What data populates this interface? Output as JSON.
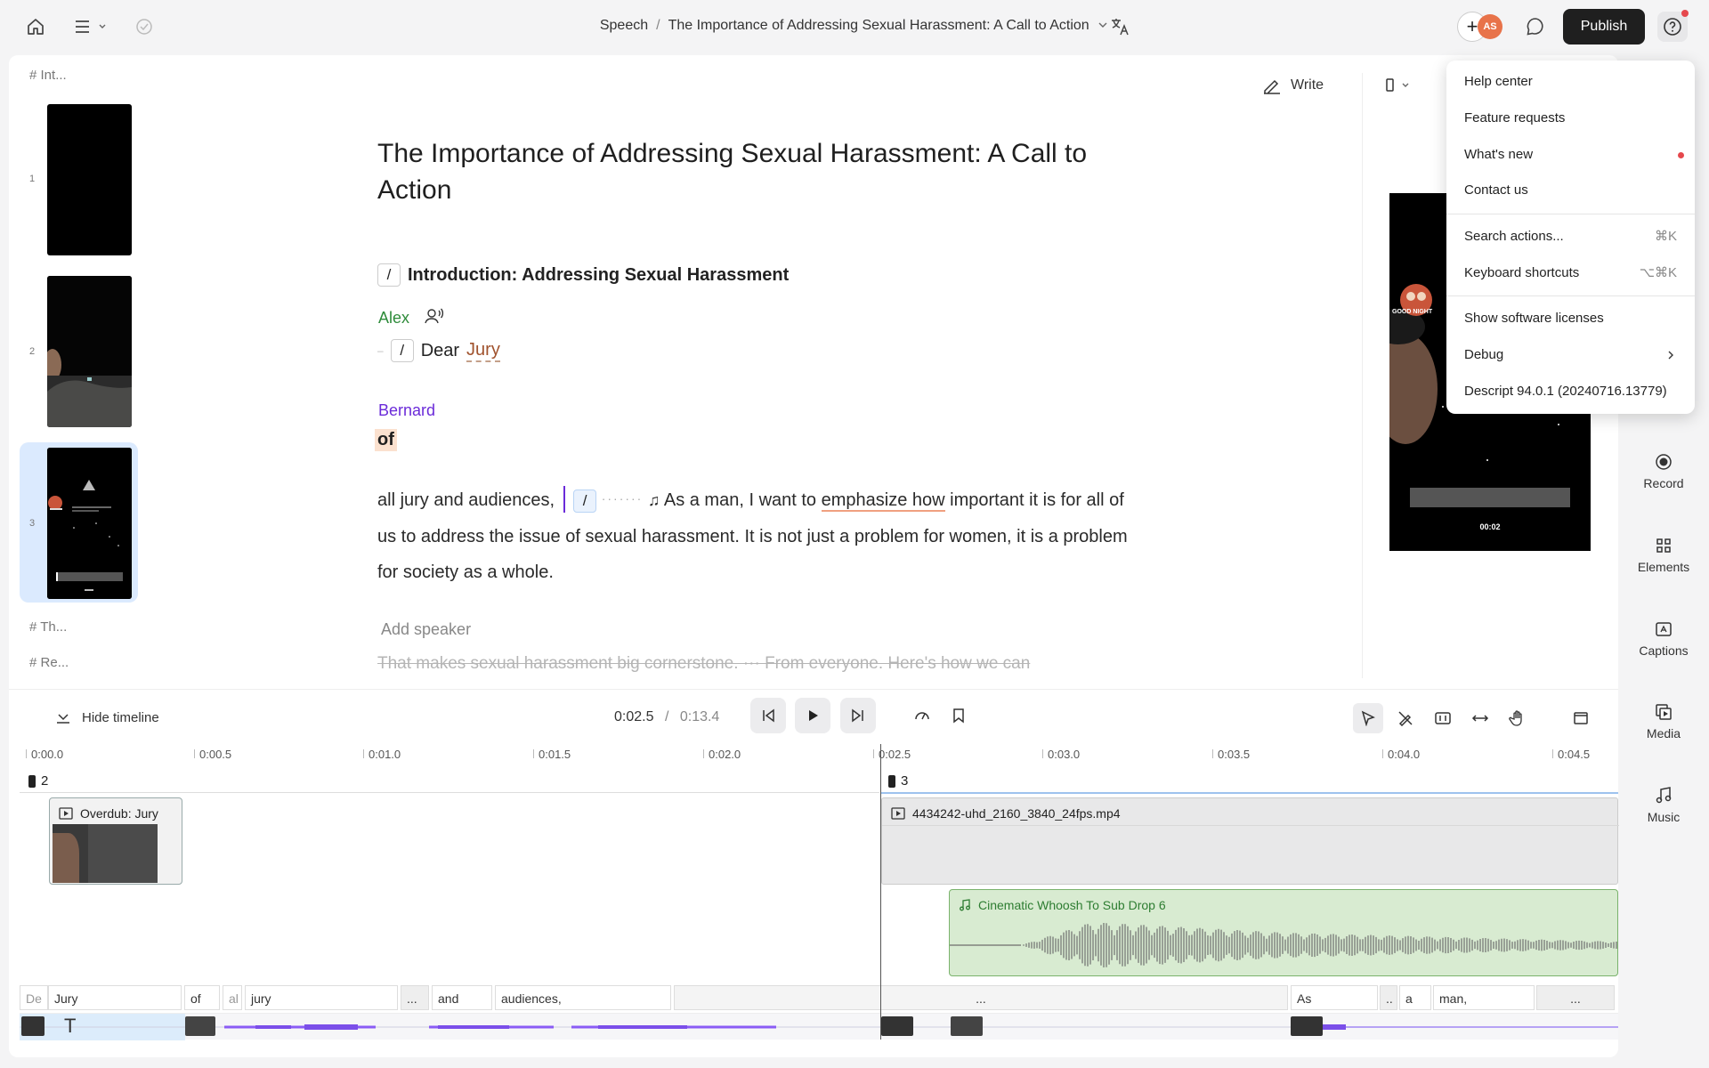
{
  "topbar": {
    "breadcrumb_project": "Speech",
    "breadcrumb_sep": "/",
    "breadcrumb_title": "The Importance of Addressing Sexual Harassment: A Call to Action",
    "avatar_initials": "AS",
    "publish_label": "Publish"
  },
  "scenes": [
    {
      "label": "Int..."
    },
    {
      "label": "Th..."
    },
    {
      "label": "Re..."
    }
  ],
  "thumbnails": [
    {
      "number": "1"
    },
    {
      "number": "2"
    },
    {
      "number": "3"
    }
  ],
  "script": {
    "title": "The Importance of Addressing Sexual Harassment: A Call to Action",
    "section_slash": "/",
    "section_heading": "Introduction: Addressing Sexual Harassment",
    "speaker_1": "Alex",
    "dear_slash": "/",
    "dear": "Dear",
    "jury": "Jury",
    "speaker_2": "Bernard",
    "of_word": "of",
    "para_start": "all jury and audiences,",
    "para_slash": "/",
    "para_p1": "As a man, I want to",
    "para_emph": "emphasize how",
    "para_p2": "important it is for all of us to address the issue of sexual harassment.",
    "para_p3": "It is not just a problem for women, it is a problem for society as a whole.",
    "add_speaker": "Add speaker",
    "struck_text": "That makes sexual harassment big cornerstone. ··· From everyone. Here's how we can"
  },
  "write_label": "Write",
  "preview": {
    "timestamp": "00:02",
    "caption_top": "GOOD NIGHT"
  },
  "right_sidebar": [
    {
      "label": "Record",
      "icon": "record-icon"
    },
    {
      "label": "Elements",
      "icon": "elements-icon"
    },
    {
      "label": "Captions",
      "icon": "captions-icon"
    },
    {
      "label": "Media",
      "icon": "media-icon"
    },
    {
      "label": "Music",
      "icon": "music-icon"
    }
  ],
  "help_menu": {
    "items": [
      {
        "label": "Help center"
      },
      {
        "label": "Feature requests"
      },
      {
        "label": "What's new"
      },
      {
        "label": "Contact us"
      },
      {
        "label": "Search actions...",
        "shortcut": "⌘K"
      },
      {
        "label": "Keyboard shortcuts",
        "shortcut": "⌥⌘K"
      },
      {
        "label": "Show software licenses"
      },
      {
        "label": "Debug"
      },
      {
        "label": "Descript 94.0.1 (20240716.13779)"
      }
    ]
  },
  "transport": {
    "hide_timeline": "Hide timeline",
    "current_time": "0:02.5",
    "time_sep": "/",
    "total_time": "0:13.4"
  },
  "timeline": {
    "ticks": [
      "0:00.0",
      "0:00.5",
      "0:01.0",
      "0:01.5",
      "0:02.0",
      "0:02.5",
      "0:03.0",
      "0:03.5",
      "0:04.0",
      "0:04.5"
    ],
    "scene_2": "2",
    "scene_3": "3",
    "overdub_clip": "Overdub: Jury",
    "video_clip": "4434242-uhd_2160_3840_24fps.mp4",
    "audio_clip": "Cinematic Whoosh To Sub Drop 6",
    "words": [
      "De",
      "Jury",
      "of",
      "al",
      "jury",
      "...",
      "and",
      "audiences,",
      "...",
      "As",
      "..",
      "a",
      "man,",
      "..."
    ]
  },
  "colors": {
    "accent_green": "#2e8b3a",
    "accent_purple": "#6b2bd9",
    "publish_bg": "#1f1f1f"
  }
}
